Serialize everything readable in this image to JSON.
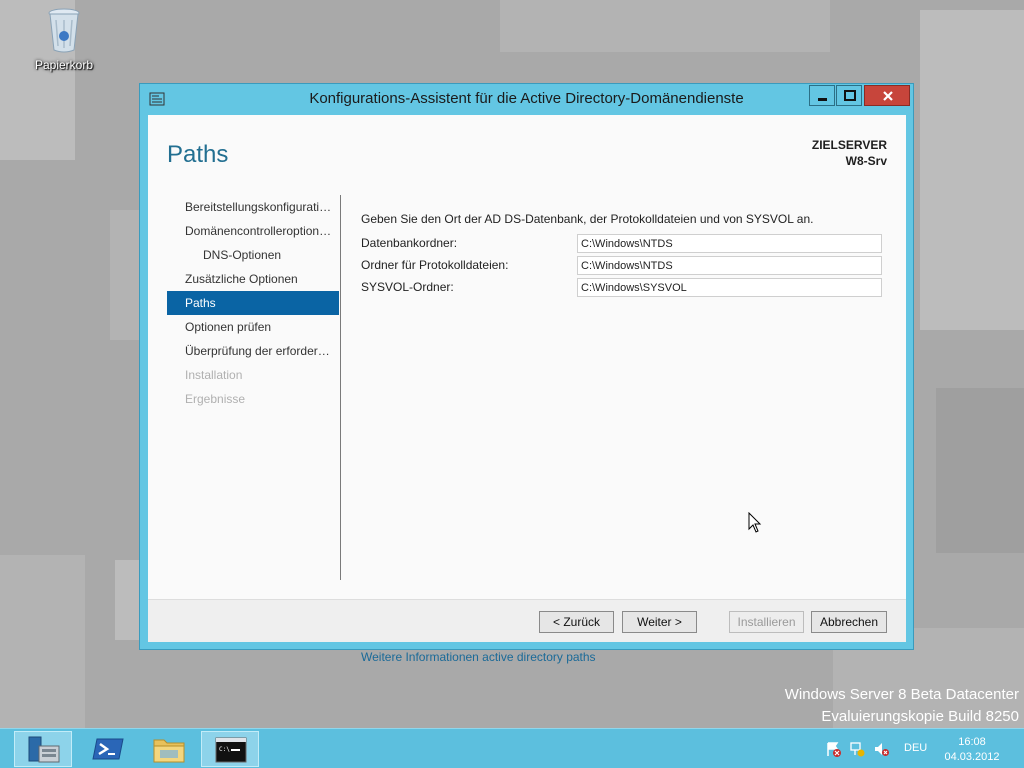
{
  "desktop": {
    "recycle_bin_label": "Papierkorb",
    "watermark_line1": "Windows Server 8 Beta Datacenter",
    "watermark_line2": "Evaluierungskopie Build 8250"
  },
  "window": {
    "title": "Konfigurations-Assistent für die Active Directory-Domänendienste",
    "page_title": "Paths",
    "server_label": "ZIELSERVER",
    "server_name": "W8-Srv"
  },
  "nav": {
    "items": [
      {
        "label": "Bereitstellungskonfigurati…",
        "state": "normal"
      },
      {
        "label": "Domänencontrolleroption…",
        "state": "normal"
      },
      {
        "label": "DNS-Optionen",
        "state": "sub"
      },
      {
        "label": "Zusätzliche Optionen",
        "state": "normal"
      },
      {
        "label": "Paths",
        "state": "active"
      },
      {
        "label": "Optionen prüfen",
        "state": "normal"
      },
      {
        "label": "Überprüfung der erforder…",
        "state": "normal"
      },
      {
        "label": "Installation",
        "state": "disabled"
      },
      {
        "label": "Ergebnisse",
        "state": "disabled"
      }
    ]
  },
  "content": {
    "intro": "Geben Sie den Ort der AD DS-Datenbank, der Protokolldateien und von SYSVOL an.",
    "fields": {
      "database": {
        "label": "Datenbankordner:",
        "value": "C:\\Windows\\NTDS"
      },
      "logs": {
        "label": "Ordner für Protokolldateien:",
        "value": "C:\\Windows\\NTDS"
      },
      "sysvol": {
        "label": "SYSVOL-Ordner:",
        "value": "C:\\Windows\\SYSVOL"
      }
    },
    "more_info_link": "Weitere Informationen active directory paths"
  },
  "buttons": {
    "back": "< Zurück",
    "next": "Weiter >",
    "install": "Installieren",
    "cancel": "Abbrechen"
  },
  "taskbar": {
    "language": "DEU",
    "time": "16:08",
    "date": "04.03.2012"
  },
  "colors": {
    "accent": "#0a64a4",
    "window_frame": "#63c6e3",
    "close_button": "#c7453b",
    "taskbar": "#5cbfde"
  }
}
